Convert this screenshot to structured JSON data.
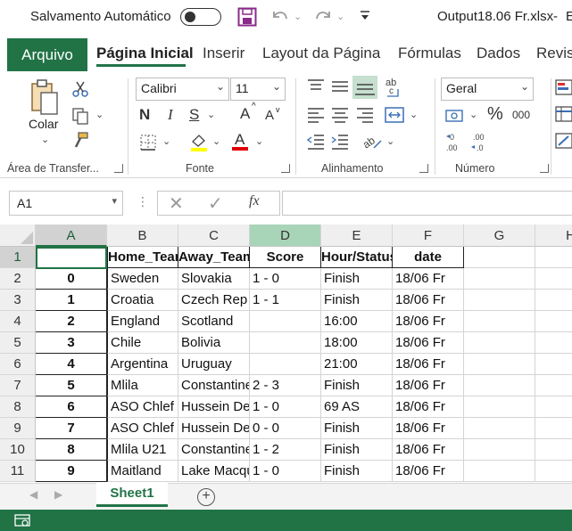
{
  "titlebar": {
    "autosave_label": "Salvamento Automático",
    "filename": "Output18.06 Fr.xlsx",
    "dash": "-",
    "trailing": "E"
  },
  "tabs": {
    "file": "Arquivo",
    "home": "Página Inicial",
    "insert": "Inserir",
    "layout": "Layout da Página",
    "formulas": "Fórmulas",
    "data": "Dados",
    "review": "Revisã"
  },
  "ribbon": {
    "clipboard": {
      "paste_label": "Colar",
      "group_label": "Área de Transfer..."
    },
    "font": {
      "name": "Calibri",
      "size": "11",
      "bold": "N",
      "italic": "I",
      "underline": "S",
      "grow": "A",
      "shrink": "A",
      "group_label": "Fonte"
    },
    "alignment": {
      "group_label": "Alinhamento"
    },
    "number": {
      "format": "Geral",
      "percent": "%",
      "thousands": "000",
      "group_label": "Número"
    }
  },
  "formula_bar": {
    "namebox": "A1",
    "fx": "fx",
    "value": ""
  },
  "grid": {
    "columns": [
      "A",
      "B",
      "C",
      "D",
      "E",
      "F",
      "G",
      "H"
    ],
    "rows": [
      "1",
      "2",
      "3",
      "4",
      "5",
      "6",
      "7",
      "8",
      "9",
      "10",
      "11"
    ],
    "header": [
      "",
      "Home_Team",
      "Away_Team",
      "Score",
      "Hour/Status",
      "date"
    ],
    "data": [
      [
        "0",
        "Sweden",
        "Slovakia",
        "1 - 0",
        "Finish",
        "18/06 Fr"
      ],
      [
        "1",
        "Croatia",
        "Czech Rep",
        "1 - 1",
        "Finish",
        "18/06 Fr"
      ],
      [
        "2",
        "England",
        "Scotland",
        "",
        "16:00",
        "18/06 Fr"
      ],
      [
        "3",
        "Chile",
        "Bolivia",
        "",
        "18:00",
        "18/06 Fr"
      ],
      [
        "4",
        "Argentina",
        "Uruguay",
        "",
        "21:00",
        "18/06 Fr"
      ],
      [
        "5",
        "Mlila",
        "Constantine",
        "2 - 3",
        "Finish",
        "18/06 Fr"
      ],
      [
        "6",
        "ASO Chlef",
        "Hussein Dey",
        "1 - 0",
        "69 AS",
        "18/06 Fr"
      ],
      [
        "7",
        "ASO Chlef",
        "Hussein Dey",
        "0 - 0",
        "Finish",
        "18/06 Fr"
      ],
      [
        "8",
        "Mlila U21",
        "Constantine",
        "1 - 2",
        "Finish",
        "18/06 Fr"
      ],
      [
        "9",
        "Maitland",
        "Lake Macquarie",
        "1 - 0",
        "Finish",
        "18/06 Fr"
      ]
    ]
  },
  "sheets": {
    "active": "Sheet1",
    "add": "+"
  },
  "colors": {
    "accent": "#217346",
    "column_highlight": "#a8d4b8"
  }
}
